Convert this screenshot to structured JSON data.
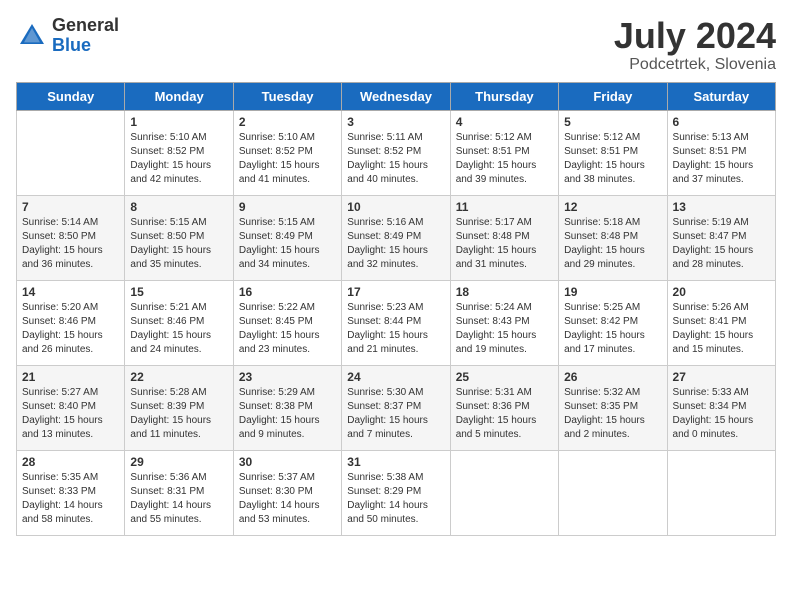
{
  "header": {
    "logo_general": "General",
    "logo_blue": "Blue",
    "month_title": "July 2024",
    "location": "Podcetrtek, Slovenia"
  },
  "days_of_week": [
    "Sunday",
    "Monday",
    "Tuesday",
    "Wednesday",
    "Thursday",
    "Friday",
    "Saturday"
  ],
  "weeks": [
    [
      {
        "day": "",
        "sunrise": "",
        "sunset": "",
        "daylight": ""
      },
      {
        "day": "1",
        "sunrise": "Sunrise: 5:10 AM",
        "sunset": "Sunset: 8:52 PM",
        "daylight": "Daylight: 15 hours and 42 minutes."
      },
      {
        "day": "2",
        "sunrise": "Sunrise: 5:10 AM",
        "sunset": "Sunset: 8:52 PM",
        "daylight": "Daylight: 15 hours and 41 minutes."
      },
      {
        "day": "3",
        "sunrise": "Sunrise: 5:11 AM",
        "sunset": "Sunset: 8:52 PM",
        "daylight": "Daylight: 15 hours and 40 minutes."
      },
      {
        "day": "4",
        "sunrise": "Sunrise: 5:12 AM",
        "sunset": "Sunset: 8:51 PM",
        "daylight": "Daylight: 15 hours and 39 minutes."
      },
      {
        "day": "5",
        "sunrise": "Sunrise: 5:12 AM",
        "sunset": "Sunset: 8:51 PM",
        "daylight": "Daylight: 15 hours and 38 minutes."
      },
      {
        "day": "6",
        "sunrise": "Sunrise: 5:13 AM",
        "sunset": "Sunset: 8:51 PM",
        "daylight": "Daylight: 15 hours and 37 minutes."
      }
    ],
    [
      {
        "day": "7",
        "sunrise": "Sunrise: 5:14 AM",
        "sunset": "Sunset: 8:50 PM",
        "daylight": "Daylight: 15 hours and 36 minutes."
      },
      {
        "day": "8",
        "sunrise": "Sunrise: 5:15 AM",
        "sunset": "Sunset: 8:50 PM",
        "daylight": "Daylight: 15 hours and 35 minutes."
      },
      {
        "day": "9",
        "sunrise": "Sunrise: 5:15 AM",
        "sunset": "Sunset: 8:49 PM",
        "daylight": "Daylight: 15 hours and 34 minutes."
      },
      {
        "day": "10",
        "sunrise": "Sunrise: 5:16 AM",
        "sunset": "Sunset: 8:49 PM",
        "daylight": "Daylight: 15 hours and 32 minutes."
      },
      {
        "day": "11",
        "sunrise": "Sunrise: 5:17 AM",
        "sunset": "Sunset: 8:48 PM",
        "daylight": "Daylight: 15 hours and 31 minutes."
      },
      {
        "day": "12",
        "sunrise": "Sunrise: 5:18 AM",
        "sunset": "Sunset: 8:48 PM",
        "daylight": "Daylight: 15 hours and 29 minutes."
      },
      {
        "day": "13",
        "sunrise": "Sunrise: 5:19 AM",
        "sunset": "Sunset: 8:47 PM",
        "daylight": "Daylight: 15 hours and 28 minutes."
      }
    ],
    [
      {
        "day": "14",
        "sunrise": "Sunrise: 5:20 AM",
        "sunset": "Sunset: 8:46 PM",
        "daylight": "Daylight: 15 hours and 26 minutes."
      },
      {
        "day": "15",
        "sunrise": "Sunrise: 5:21 AM",
        "sunset": "Sunset: 8:46 PM",
        "daylight": "Daylight: 15 hours and 24 minutes."
      },
      {
        "day": "16",
        "sunrise": "Sunrise: 5:22 AM",
        "sunset": "Sunset: 8:45 PM",
        "daylight": "Daylight: 15 hours and 23 minutes."
      },
      {
        "day": "17",
        "sunrise": "Sunrise: 5:23 AM",
        "sunset": "Sunset: 8:44 PM",
        "daylight": "Daylight: 15 hours and 21 minutes."
      },
      {
        "day": "18",
        "sunrise": "Sunrise: 5:24 AM",
        "sunset": "Sunset: 8:43 PM",
        "daylight": "Daylight: 15 hours and 19 minutes."
      },
      {
        "day": "19",
        "sunrise": "Sunrise: 5:25 AM",
        "sunset": "Sunset: 8:42 PM",
        "daylight": "Daylight: 15 hours and 17 minutes."
      },
      {
        "day": "20",
        "sunrise": "Sunrise: 5:26 AM",
        "sunset": "Sunset: 8:41 PM",
        "daylight": "Daylight: 15 hours and 15 minutes."
      }
    ],
    [
      {
        "day": "21",
        "sunrise": "Sunrise: 5:27 AM",
        "sunset": "Sunset: 8:40 PM",
        "daylight": "Daylight: 15 hours and 13 minutes."
      },
      {
        "day": "22",
        "sunrise": "Sunrise: 5:28 AM",
        "sunset": "Sunset: 8:39 PM",
        "daylight": "Daylight: 15 hours and 11 minutes."
      },
      {
        "day": "23",
        "sunrise": "Sunrise: 5:29 AM",
        "sunset": "Sunset: 8:38 PM",
        "daylight": "Daylight: 15 hours and 9 minutes."
      },
      {
        "day": "24",
        "sunrise": "Sunrise: 5:30 AM",
        "sunset": "Sunset: 8:37 PM",
        "daylight": "Daylight: 15 hours and 7 minutes."
      },
      {
        "day": "25",
        "sunrise": "Sunrise: 5:31 AM",
        "sunset": "Sunset: 8:36 PM",
        "daylight": "Daylight: 15 hours and 5 minutes."
      },
      {
        "day": "26",
        "sunrise": "Sunrise: 5:32 AM",
        "sunset": "Sunset: 8:35 PM",
        "daylight": "Daylight: 15 hours and 2 minutes."
      },
      {
        "day": "27",
        "sunrise": "Sunrise: 5:33 AM",
        "sunset": "Sunset: 8:34 PM",
        "daylight": "Daylight: 15 hours and 0 minutes."
      }
    ],
    [
      {
        "day": "28",
        "sunrise": "Sunrise: 5:35 AM",
        "sunset": "Sunset: 8:33 PM",
        "daylight": "Daylight: 14 hours and 58 minutes."
      },
      {
        "day": "29",
        "sunrise": "Sunrise: 5:36 AM",
        "sunset": "Sunset: 8:31 PM",
        "daylight": "Daylight: 14 hours and 55 minutes."
      },
      {
        "day": "30",
        "sunrise": "Sunrise: 5:37 AM",
        "sunset": "Sunset: 8:30 PM",
        "daylight": "Daylight: 14 hours and 53 minutes."
      },
      {
        "day": "31",
        "sunrise": "Sunrise: 5:38 AM",
        "sunset": "Sunset: 8:29 PM",
        "daylight": "Daylight: 14 hours and 50 minutes."
      },
      {
        "day": "",
        "sunrise": "",
        "sunset": "",
        "daylight": ""
      },
      {
        "day": "",
        "sunrise": "",
        "sunset": "",
        "daylight": ""
      },
      {
        "day": "",
        "sunrise": "",
        "sunset": "",
        "daylight": ""
      }
    ]
  ]
}
